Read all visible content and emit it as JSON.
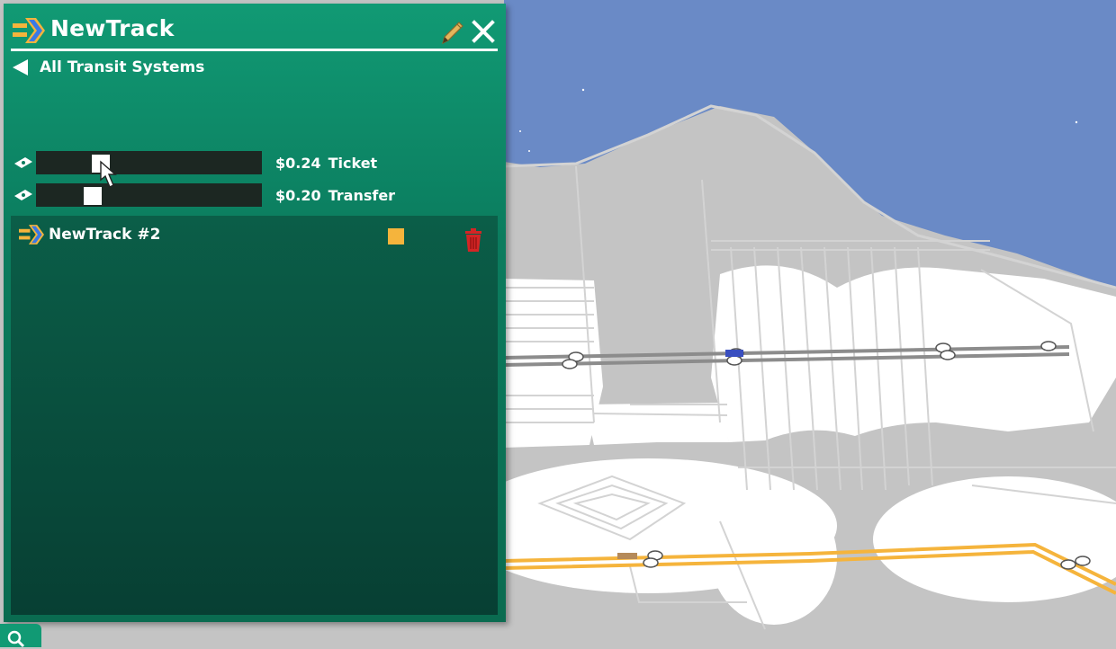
{
  "window": {
    "title": "NewTrack",
    "edit_icon": "pencil-icon",
    "close_icon": "close-icon"
  },
  "nav": {
    "back_label": "All Transit Systems",
    "back_icon": "triangle-left-icon"
  },
  "fares": [
    {
      "icon": "ticket-icon",
      "value_text": "$0.24",
      "label": "Ticket",
      "slider_fraction": 0.27
    },
    {
      "icon": "ticket-icon",
      "value_text": "$0.20",
      "label": "Transfer",
      "slider_fraction": 0.23
    }
  ],
  "lines": [
    {
      "name": "NewTrack #2",
      "color": "#f5b43c",
      "icon": "transit-logo-icon",
      "delete_icon": "trash-icon"
    }
  ],
  "colors": {
    "panel": "#119a74",
    "panel_dark": "#073f33",
    "accent_orange": "#f5b43c",
    "accent_blue": "#3a79e6",
    "delete_red": "#d42525",
    "water": "#6a8ac6"
  },
  "footer": {
    "search_icon": "search-icon"
  }
}
